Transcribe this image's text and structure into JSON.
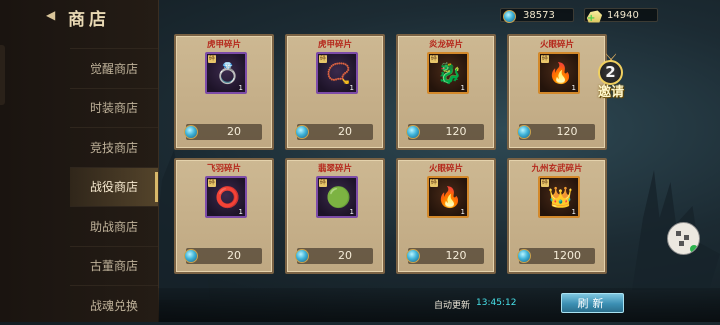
{
  "shop": {
    "title": "商店",
    "back_icon": "back-arrow-icon"
  },
  "currency": {
    "gems": "38573",
    "silver": "14940"
  },
  "nav": {
    "items": [
      {
        "label": "觉醒商店",
        "active": false
      },
      {
        "label": "时装商店",
        "active": false
      },
      {
        "label": "竞技商店",
        "active": false
      },
      {
        "label": "战役商店",
        "active": true
      },
      {
        "label": "助战商店",
        "active": false
      },
      {
        "label": "古董商店",
        "active": false
      },
      {
        "label": "战魂兑换",
        "active": false
      }
    ]
  },
  "items": [
    {
      "name": "虎甲碎片",
      "price": "20",
      "qty": "1",
      "frag": "碎",
      "icon": "ring-icon",
      "glyph": "💍",
      "frame": "purple"
    },
    {
      "name": "虎甲碎片",
      "price": "20",
      "qty": "1",
      "frag": "碎",
      "icon": "necklace-icon",
      "glyph": "📿",
      "frame": "purple"
    },
    {
      "name": "炎龙碎片",
      "price": "120",
      "qty": "1",
      "frag": "碎",
      "icon": "fire-dragon-icon",
      "glyph": "🐉",
      "frame": "orange"
    },
    {
      "name": "火眼碎片",
      "price": "120",
      "qty": "1",
      "frag": "碎",
      "icon": "fire-amulet-icon",
      "glyph": "🔥",
      "frame": "orange"
    },
    {
      "name": "飞羽碎片",
      "price": "20",
      "qty": "1",
      "frag": "碎",
      "icon": "dark-ring-icon",
      "glyph": "⭕",
      "frame": "purple"
    },
    {
      "name": "翡翠碎片",
      "price": "20",
      "qty": "1",
      "frag": "碎",
      "icon": "jade-pendant-icon",
      "glyph": "🟢",
      "frame": "purple"
    },
    {
      "name": "火眼碎片",
      "price": "120",
      "qty": "1",
      "frag": "碎",
      "icon": "fire-amulet-icon",
      "glyph": "🔥",
      "frame": "orange"
    },
    {
      "name": "九州玄武碎片",
      "price": "1200",
      "qty": "1",
      "frag": "碎",
      "icon": "golden-helmet-icon",
      "glyph": "👑",
      "frame": "orange"
    }
  ],
  "footer": {
    "auto_refresh_label": "自动更新",
    "auto_refresh_time": "13:45:12",
    "refresh_button": "刷新"
  },
  "invite": {
    "count": "2",
    "label": "邀请"
  },
  "colors": {
    "accent_cyan": "#47e0e8",
    "item_name_red": "#b5281c",
    "card_bg": "#cdb892"
  }
}
